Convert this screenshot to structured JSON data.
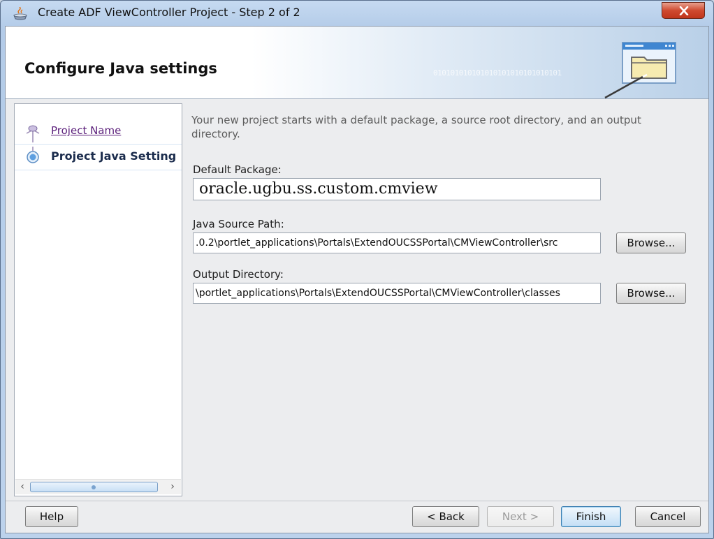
{
  "window": {
    "title": "Create ADF ViewController Project - Step 2 of 2",
    "icon": "java-cup-icon",
    "close_icon": "close-icon"
  },
  "header": {
    "title": "Configure Java settings",
    "binary_decoration": "010101010101010101010101010101",
    "graphic_icon": "folder-window-icon"
  },
  "steps": [
    {
      "label": "Project Name",
      "state": "visited",
      "icon": "step-node-icon"
    },
    {
      "label": "Project Java Setting",
      "state": "current",
      "icon": "step-current-icon"
    }
  ],
  "form": {
    "intro": "Your new project starts with a default package, a source root directory, and an output directory.",
    "default_package": {
      "label": "Default Package:",
      "value": "oracle.ugbu.ss.custom.cmview"
    },
    "java_source_path": {
      "label": "Java Source Path:",
      "value": ".0.2\\portlet_applications\\Portals\\ExtendOUCSSPortal\\CMViewController\\src",
      "browse_label": "Browse..."
    },
    "output_directory": {
      "label": "Output Directory:",
      "value": "\\portlet_applications\\Portals\\ExtendOUCSSPortal\\CMViewController\\classes",
      "browse_label": "Browse..."
    }
  },
  "footer": {
    "help": "Help",
    "back": "< Back",
    "next": "Next >",
    "finish": "Finish",
    "cancel": "Cancel"
  },
  "colors": {
    "visited_link": "#5a1e7a",
    "current_step": "#1a2b4c",
    "close_button": "#cf4a30",
    "default_button_border": "#3c7fb1"
  }
}
